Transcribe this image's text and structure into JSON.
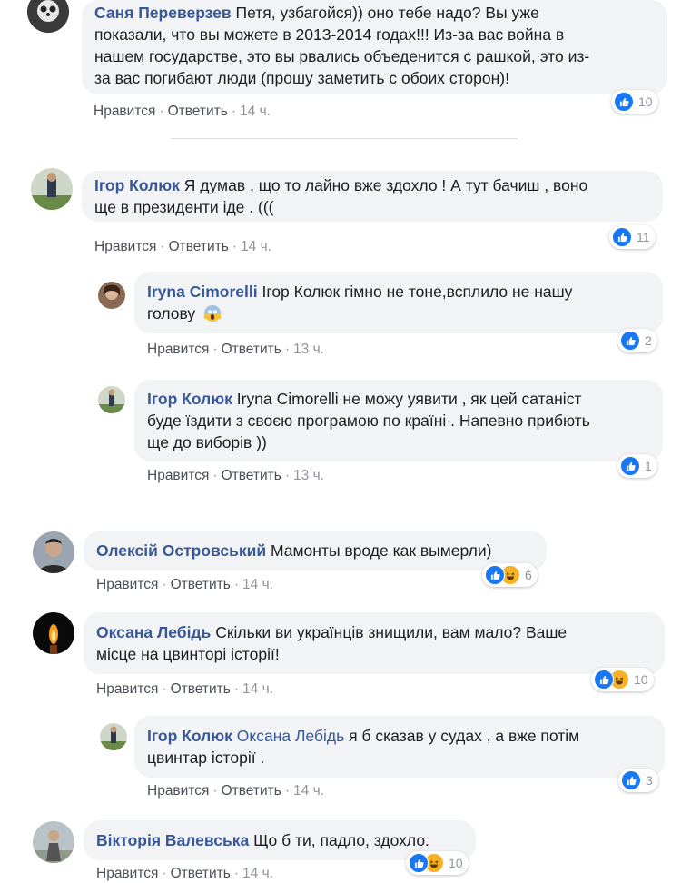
{
  "action_labels": {
    "like": "Нравится",
    "reply": "Ответить",
    "sep": "·"
  },
  "colors": {
    "author": "#385898",
    "bubble": "#f2f3f5",
    "like": "#1877f2",
    "haha": "#f7b125"
  },
  "comments": [
    {
      "author": "Саня Переверзев",
      "lines": [
        "Петя, узбагойся)) оно тебе надо? Вы уже",
        "показали, что вы можете в 2013-2014 годах!!! Из-за вас война в",
        "нашем государстве, это вы рвались объеденится с рашкой, это из-",
        "за вас погибают люди (прошу заметить с обоих сторон)!"
      ],
      "time": "14 ч.",
      "reactions": [
        "like"
      ],
      "count": "10"
    },
    {
      "author": "Ігор Колюк",
      "lines": [
        "Я думав , що то лайно вже здохло ! А тут бачиш , воно",
        "ще в президенти іде . ((("
      ],
      "time": "14 ч.",
      "reactions": [
        "like"
      ],
      "count": "11"
    },
    {
      "author": "Iryna Cimorelli",
      "lines": [
        "Ігор Колюк гімно не тоне,всплило не нашу",
        "голову"
      ],
      "emoji": "scream-emoji",
      "time": "13 ч.",
      "reactions": [
        "like"
      ],
      "count": "2"
    },
    {
      "author": "Ігор Колюк",
      "lines": [
        "Iryna Cimorelli не можу уявити , як цей сатаніст",
        "буде їздити з своєю програмою по країні . Напевно прибють",
        "ще до виборів ))"
      ],
      "time": "13 ч.",
      "reactions": [
        "like"
      ],
      "count": "1"
    },
    {
      "author": "Олексій Островський",
      "lines": [
        "Мамонты вроде как вымерли)"
      ],
      "time": "14 ч.",
      "reactions": [
        "like",
        "haha"
      ],
      "count": "6"
    },
    {
      "author": "Оксана Лебідь",
      "lines": [
        "Скільки ви українців знищили, вам мало? Ваше",
        "місце на цвинторі історії!"
      ],
      "time": "14 ч.",
      "reactions": [
        "like",
        "haha"
      ],
      "count": "10"
    },
    {
      "author": "Ігор Колюк",
      "mention": "Оксана Лебідь",
      "lines": [
        "я б сказав у судах , а вже потім",
        "цвинтар історії ."
      ],
      "time": "14 ч.",
      "reactions": [
        "like"
      ],
      "count": "3"
    },
    {
      "author": "Вікторія Валевська",
      "lines": [
        "Що б ти, падло, здохло."
      ],
      "time": "14 ч.",
      "reactions": [
        "like",
        "haha"
      ],
      "count": "10"
    }
  ]
}
